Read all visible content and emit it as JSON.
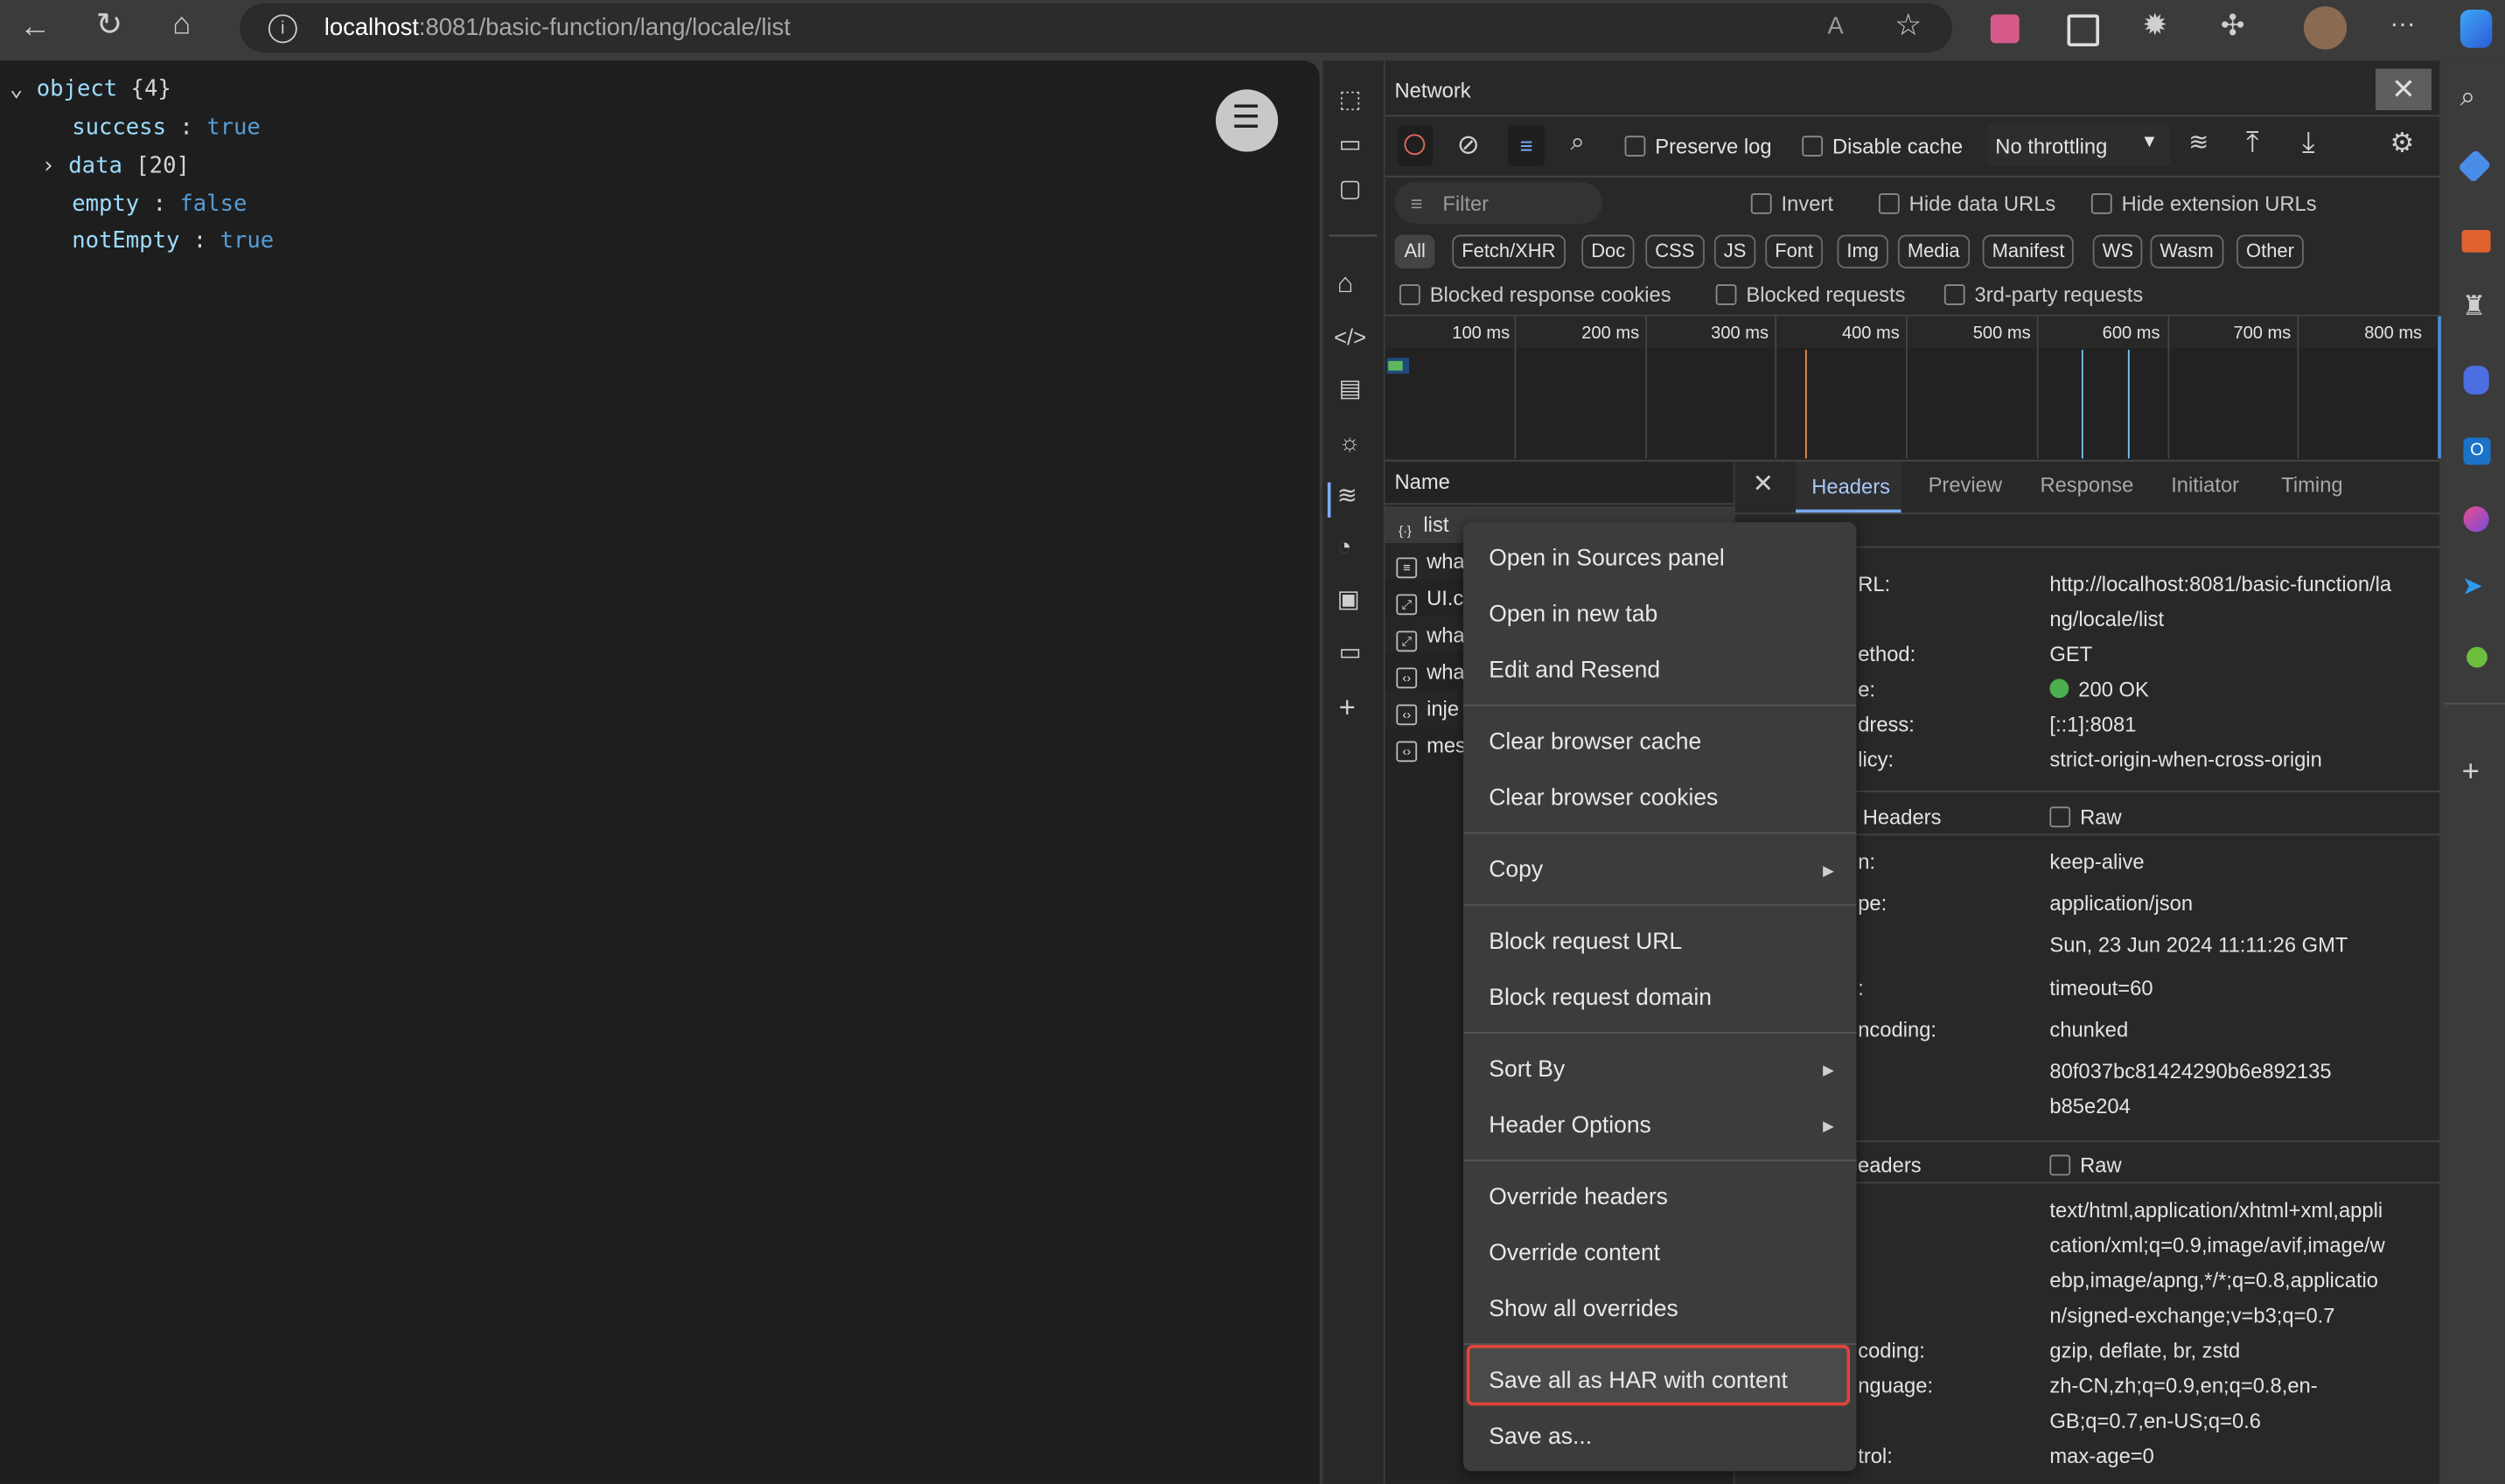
{
  "browser": {
    "url_host": "localhost",
    "url_path": ":8081/basic-function/lang/locale/list"
  },
  "json_view": {
    "root": "object",
    "root_count": "{4}",
    "fields": [
      {
        "key": "success",
        "value": "true"
      },
      {
        "key": "data",
        "value": "[20]",
        "expandable": true
      },
      {
        "key": "empty",
        "value": "false"
      },
      {
        "key": "notEmpty",
        "value": "true"
      }
    ]
  },
  "devtools": {
    "title": "Network",
    "toolbar": {
      "preserve_log": "Preserve log",
      "disable_cache": "Disable cache",
      "throttling": "No throttling"
    },
    "filter": {
      "placeholder": "Filter",
      "invert": "Invert",
      "hide_data_urls": "Hide data URLs",
      "hide_extension_urls": "Hide extension URLs"
    },
    "types": [
      "All",
      "Fetch/XHR",
      "Doc",
      "CSS",
      "JS",
      "Font",
      "Img",
      "Media",
      "Manifest",
      "WS",
      "Wasm",
      "Other"
    ],
    "blocked": {
      "cookies": "Blocked response cookies",
      "requests": "Blocked requests",
      "third_party": "3rd-party requests"
    },
    "timeline_ticks": [
      "100 ms",
      "200 ms",
      "300 ms",
      "400 ms",
      "500 ms",
      "600 ms",
      "700 ms",
      "800 ms"
    ],
    "name_header": "Name",
    "requests": [
      {
        "name": "list",
        "icon": "{·}"
      },
      {
        "name": "wha",
        "icon": "≡"
      },
      {
        "name": "UI.c",
        "icon": "⤢"
      },
      {
        "name": "wha",
        "icon": "⤢"
      },
      {
        "name": "wha",
        "icon": "‹›"
      },
      {
        "name": "inje",
        "icon": "‹›"
      },
      {
        "name": "mes",
        "icon": "‹›"
      }
    ],
    "detail_tabs": [
      "Headers",
      "Preview",
      "Response",
      "Initiator",
      "Timing"
    ],
    "general": [
      {
        "label": "RL:",
        "value": "http://localhost:8081/basic-function/la",
        "value2": "ng/locale/list"
      },
      {
        "label": "ethod:",
        "value": "GET"
      },
      {
        "label": "e:",
        "value": "200 OK"
      },
      {
        "label": "dress:",
        "value": "[::1]:8081"
      },
      {
        "label": "licy:",
        "value": "strict-origin-when-cross-origin"
      }
    ],
    "response_headers_title": "Headers",
    "raw": "Raw",
    "response_headers": [
      {
        "label": "n:",
        "value": "keep-alive"
      },
      {
        "label": "pe:",
        "value": "application/json"
      },
      {
        "label": "",
        "value": "Sun, 23 Jun 2024 11:11:26 GMT"
      },
      {
        "label": ":",
        "value": "timeout=60"
      },
      {
        "label": "ncoding:",
        "value": "chunked"
      },
      {
        "label": "",
        "value": "80f037bc81424290b6e892135",
        "value2": "b85e204"
      }
    ],
    "request_headers_title": "leaders",
    "request_headers": [
      {
        "label": "",
        "lines": [
          "text/html,application/xhtml+xml,appli",
          "cation/xml;q=0.9,image/avif,image/w",
          "ebp,image/apng,*/*;q=0.8,applicatio",
          "n/signed-exchange;v=b3;q=0.7"
        ]
      },
      {
        "label": "coding:",
        "lines": [
          "gzip, deflate, br, zstd"
        ]
      },
      {
        "label": "nguage:",
        "lines": [
          "zh-CN,zh;q=0.9,en;q=0.8,en-",
          "GB;q=0.7,en-US;q=0.6"
        ]
      },
      {
        "label": "trol:",
        "lines": [
          "max-age=0"
        ]
      }
    ]
  },
  "context_menu": {
    "items": [
      "Open in Sources panel",
      "Open in new tab",
      "Edit and Resend",
      "Clear browser cache",
      "Clear browser cookies",
      "Copy",
      "Block request URL",
      "Block request domain",
      "Sort By",
      "Header Options",
      "Override headers",
      "Override content",
      "Show all overrides",
      "Save all as HAR with content",
      "Save as..."
    ],
    "highlighted": "Save all as HAR with content"
  },
  "colors": {
    "highlight_border": "#e0443a",
    "status_ok": "#4caf50",
    "accent": "#7cacf8"
  }
}
